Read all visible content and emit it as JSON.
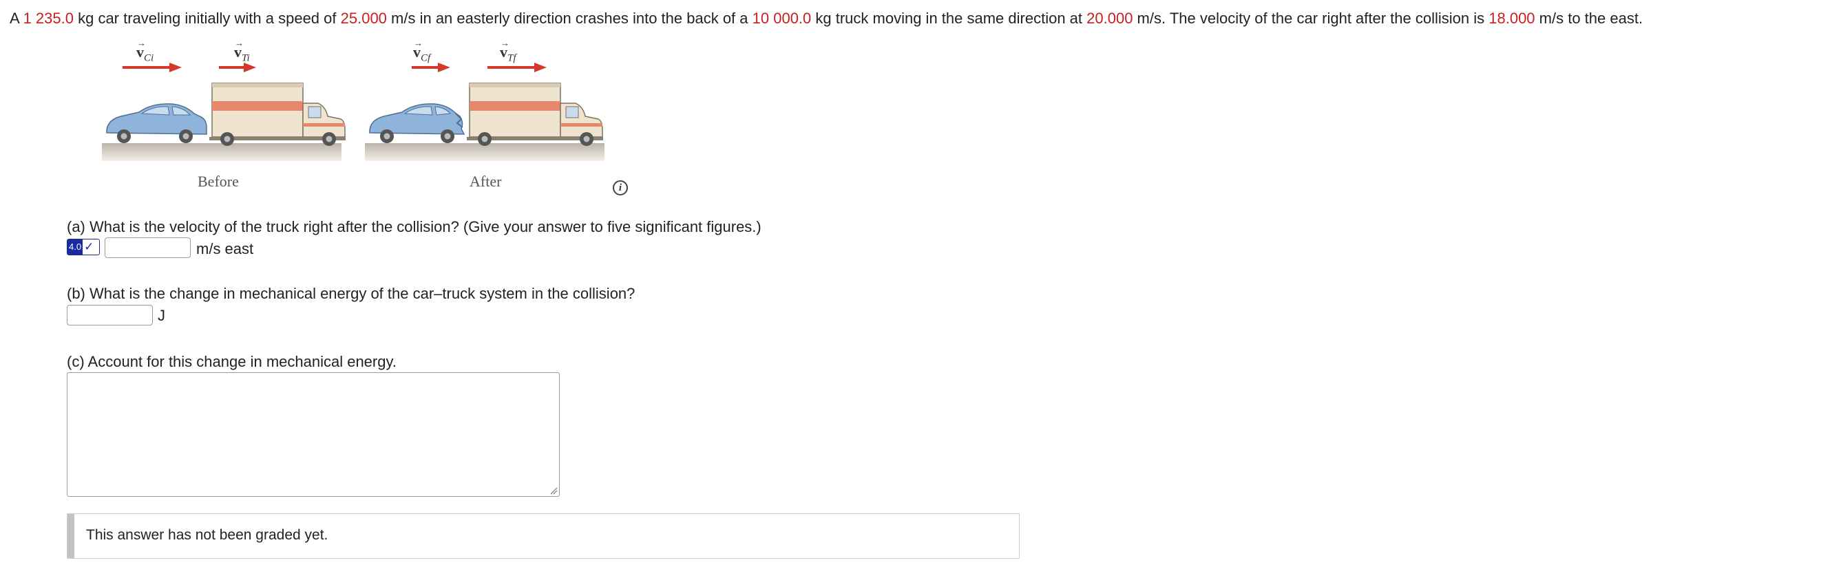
{
  "problem": {
    "t1": "A ",
    "car_mass": "1 235.0",
    "t2": " kg car traveling initially with a speed of ",
    "car_speed": "25.000",
    "t3": " m/s in an easterly direction crashes into the back of a ",
    "truck_mass": "10 000.0",
    "t4": " kg truck moving in the same direction at ",
    "truck_speed": "20.000",
    "t5": " m/s. The velocity of the car right after the collision is ",
    "car_final_speed": "18.000",
    "t6": " m/s to the east."
  },
  "figure": {
    "before_label": "Before",
    "after_label": "After",
    "vectors": {
      "v_ci": {
        "symbol": "v",
        "sub": "Ci"
      },
      "v_ti": {
        "symbol": "v",
        "sub": "Ti"
      },
      "v_cf": {
        "symbol": "v",
        "sub": "Cf"
      },
      "v_tf": {
        "symbol": "v",
        "sub": "Tf"
      }
    },
    "info_icon": "info-icon",
    "arrow_color": "#d33a2c",
    "car_color": "#8fb4dc",
    "truck_stripe_color": "#e8876b"
  },
  "part_a": {
    "question": "(a) What is the velocity of the truck right after the collision? (Give your answer to five significant figures.)",
    "badge_score": "4.0",
    "badge_icon": "checkmark-icon",
    "answer_value": "",
    "unit": "m/s east"
  },
  "part_b": {
    "question": "(b) What is the change in mechanical energy of the car–truck system in the collision?",
    "answer_value": "",
    "unit": "J"
  },
  "part_c": {
    "question": "(c) Account for this change in mechanical energy.",
    "answer_value": ""
  },
  "grading": {
    "status": "This answer has not been graded yet."
  }
}
